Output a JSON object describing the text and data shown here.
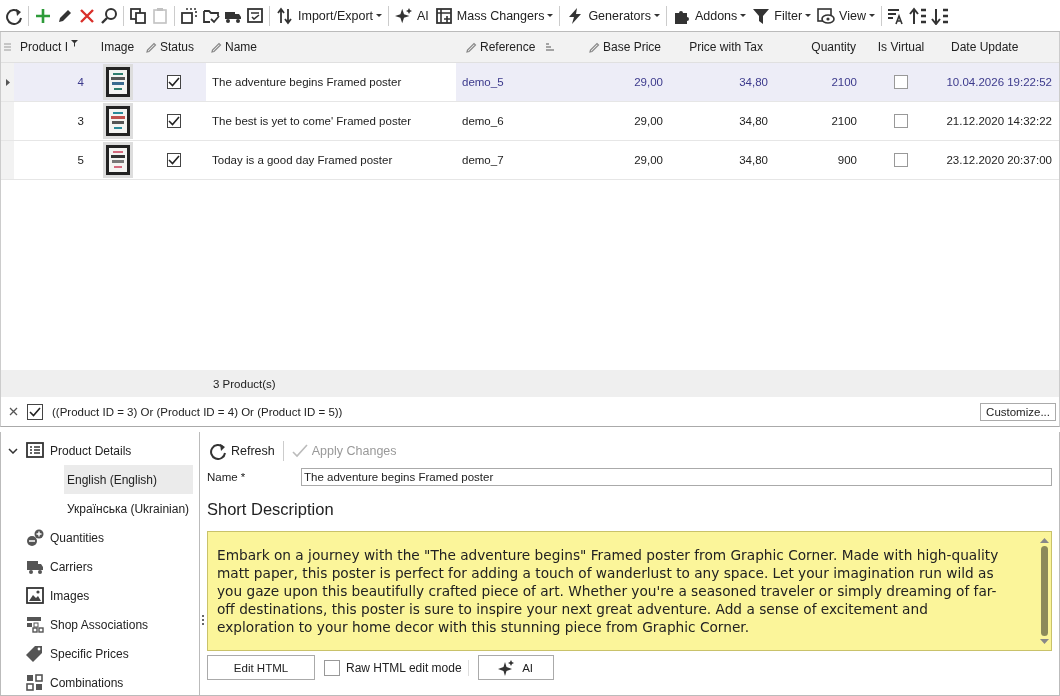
{
  "toolbar": [
    {
      "kind": "icon",
      "disabled": false
    },
    {
      "kind": "icon",
      "disabled": false
    },
    {
      "kind": "icon",
      "disabled": false
    },
    {
      "kind": "icon",
      "disabled": false
    },
    {
      "kind": "icon",
      "disabled": false
    },
    {
      "kind": "icon",
      "disabled": false
    },
    {
      "kind": "icon",
      "disabled": true
    },
    {
      "kind": "icon",
      "disabled": false
    },
    {
      "kind": "icon",
      "disabled": false
    },
    {
      "kind": "icon",
      "disabled": false
    },
    {
      "kind": "icon",
      "disabled": false
    },
    {
      "kind": "menu",
      "label": "Import/Export",
      "disabled": false
    },
    {
      "kind": "button",
      "label": "AI",
      "disabled": false
    },
    {
      "kind": "menu",
      "label": "Mass Changers",
      "disabled": false
    },
    {
      "kind": "menu",
      "label": "Generators",
      "disabled": false
    },
    {
      "kind": "menu",
      "label": "Addons",
      "disabled": false
    },
    {
      "kind": "menu",
      "label": "Filter",
      "disabled": false
    },
    {
      "kind": "menu",
      "label": "View",
      "disabled": false
    },
    {
      "kind": "icon",
      "disabled": false
    },
    {
      "kind": "icon",
      "disabled": false
    },
    {
      "kind": "icon",
      "disabled": false
    }
  ],
  "table": {
    "columns": [
      {
        "label": "Product I",
        "editable": false,
        "filtered": true,
        "grouped": false
      },
      {
        "label": "Image",
        "editable": false,
        "filtered": false,
        "grouped": false
      },
      {
        "label": "Status",
        "editable": true,
        "filtered": false,
        "grouped": false
      },
      {
        "label": "Name",
        "editable": true,
        "filtered": false,
        "grouped": false
      },
      {
        "label": "Reference",
        "editable": true,
        "filtered": false,
        "grouped": true
      },
      {
        "label": "Base Price",
        "editable": true,
        "filtered": false,
        "grouped": false
      },
      {
        "label": "Price with Tax",
        "editable": false,
        "filtered": false,
        "grouped": false
      },
      {
        "label": "Quantity",
        "editable": false,
        "filtered": false,
        "grouped": false
      },
      {
        "label": "Is Virtual",
        "editable": false,
        "filtered": false,
        "grouped": false
      },
      {
        "label": "Date Update",
        "editable": false,
        "filtered": false,
        "grouped": false
      }
    ],
    "rows": [
      {
        "selected": true,
        "id": "4",
        "status": true,
        "name": "The adventure begins Framed poster",
        "reference": "demo_5",
        "base_price": "29,00",
        "price_with_tax": "34,80",
        "quantity": "2100",
        "is_virtual": false,
        "date_update": "10.04.2026 19:22:52"
      },
      {
        "selected": false,
        "id": "3",
        "status": true,
        "name": "The best is yet to come' Framed poster",
        "reference": "demo_6",
        "base_price": "29,00",
        "price_with_tax": "34,80",
        "quantity": "2100",
        "is_virtual": false,
        "date_update": "21.12.2020 14:32:22"
      },
      {
        "selected": false,
        "id": "5",
        "status": true,
        "name": "Today is a good day Framed poster",
        "reference": "demo_7",
        "base_price": "29,00",
        "price_with_tax": "34,80",
        "quantity": "900",
        "is_virtual": false,
        "date_update": "23.12.2020 20:37:00"
      }
    ],
    "footer": "3 Product(s)"
  },
  "filter_bar": {
    "enabled": true,
    "expression": "((Product ID = 3) Or (Product ID = 4) Or (Product ID = 5))",
    "customize_button": "Customize..."
  },
  "sidebar": {
    "items": [
      {
        "label": "Product Details",
        "expanded": true,
        "selected": false,
        "children": [
          {
            "label": "English (English)",
            "selected": true
          },
          {
            "label": "Українська (Ukrainian)",
            "selected": false
          }
        ]
      },
      {
        "label": "Quantities",
        "selected": false
      },
      {
        "label": "Carriers",
        "selected": false
      },
      {
        "label": "Images",
        "selected": false
      },
      {
        "label": "Shop Associations",
        "selected": false
      },
      {
        "label": "Specific Prices",
        "selected": false
      },
      {
        "label": "Combinations",
        "selected": false
      }
    ]
  },
  "editor": {
    "toolbar": [
      {
        "label": "Refresh",
        "disabled": false
      },
      {
        "label": "Apply Changes",
        "disabled": true
      }
    ],
    "name_label": "Name *",
    "name_value": "The adventure begins Framed poster",
    "section_title": "Short Description",
    "short_description": "Embark on a journey with the \"The adventure begins\" Framed poster from Graphic Corner. Made with high-quality matt paper, this poster is perfect for adding a touch of wanderlust to any space. Let your imagination run wild as you gaze upon this beautifully crafted piece of art. Whether you're a seasoned traveler or simply dreaming of far-off destinations, this poster is sure to inspire your next great adventure. Add a sense of excitement and exploration to your home decor with this stunning piece from Graphic Corner.",
    "edit_html_button": "Edit HTML",
    "raw_html": {
      "label": "Raw HTML edit mode",
      "checked": false
    },
    "ai_button": "AI"
  }
}
